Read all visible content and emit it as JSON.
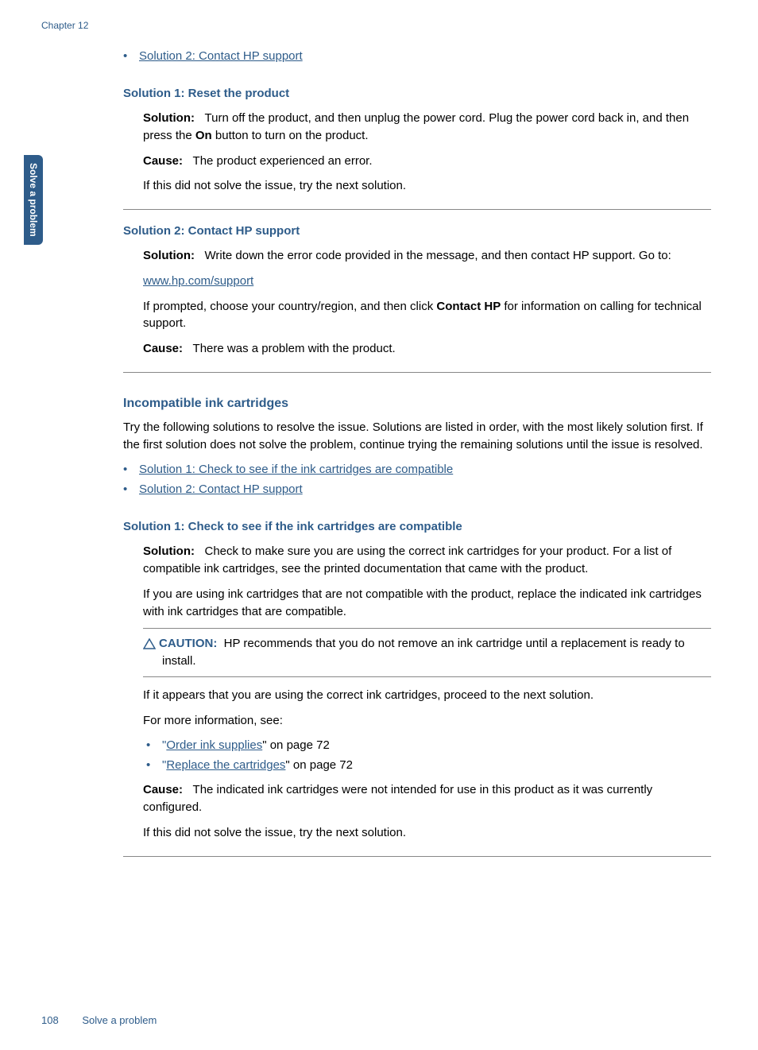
{
  "chapter": "Chapter 12",
  "sideTab": "Solve a problem",
  "topBullet": {
    "link": "Solution 2: Contact HP support"
  },
  "solution1Reset": {
    "heading": "Solution 1: Reset the product",
    "solutionLabel": "Solution:",
    "solutionText": "Turn off the product, and then unplug the power cord. Plug the power cord back in, and then press the ",
    "onBold": "On",
    "solutionText2": " button to turn on the product.",
    "causeLabel": "Cause:",
    "causeText": "The product experienced an error.",
    "tryNext": "If this did not solve the issue, try the next solution."
  },
  "solution2Contact": {
    "heading": "Solution 2: Contact HP support",
    "solutionLabel": "Solution:",
    "solutionText": "Write down the error code provided in the message, and then contact HP support. Go to:",
    "supportLink": "www.hp.com/support",
    "promptText1": "If prompted, choose your country/region, and then click ",
    "contactBold": "Contact HP",
    "promptText2": " for information on calling for technical support.",
    "causeLabel": "Cause:",
    "causeText": "There was a problem with the product."
  },
  "incompatible": {
    "heading": "Incompatible ink cartridges",
    "intro": "Try the following solutions to resolve the issue. Solutions are listed in order, with the most likely solution first. If the first solution does not solve the problem, continue trying the remaining solutions until the issue is resolved.",
    "bullet1": "Solution 1: Check to see if the ink cartridges are compatible",
    "bullet2": "Solution 2: Contact HP support"
  },
  "solution1Check": {
    "heading": "Solution 1: Check to see if the ink cartridges are compatible",
    "solutionLabel": "Solution:",
    "solutionText": "Check to make sure you are using the correct ink cartridges for your product. For a list of compatible ink cartridges, see the printed documentation that came with the product.",
    "replaceText": "If you are using ink cartridges that are not compatible with the product, replace the indicated ink cartridges with ink cartridges that are compatible.",
    "cautionLabel": "CAUTION:",
    "cautionText": "HP recommends that you do not remove an ink cartridge until a replacement is ready to install.",
    "proceedText": "If it appears that you are using the correct ink cartridges, proceed to the next solution.",
    "moreInfo": "For more information, see:",
    "orderLink": "Order ink supplies",
    "orderPage": "\" on page 72",
    "replaceLink": "Replace the cartridges",
    "replacePage": "\" on page 72",
    "causeLabel": "Cause:",
    "causeText": "The indicated ink cartridges were not intended for use in this product as it was currently configured.",
    "tryNext": "If this did not solve the issue, try the next solution."
  },
  "footer": {
    "pageNum": "108",
    "section": "Solve a problem"
  }
}
